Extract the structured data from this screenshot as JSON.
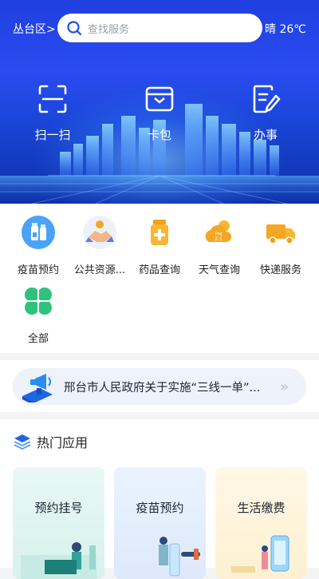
{
  "header": {
    "district": "丛台区>",
    "search_placeholder": "查找服务",
    "weather": "晴 26℃"
  },
  "quick_actions": [
    {
      "label": "扫一扫",
      "icon": "scan-icon"
    },
    {
      "label": "卡包",
      "icon": "card-wallet-icon"
    },
    {
      "label": "办事",
      "icon": "document-edit-icon"
    }
  ],
  "services": [
    {
      "label": "疫苗预约",
      "icon": "vaccine-icon"
    },
    {
      "label": "公共资源...",
      "icon": "handshake-icon"
    },
    {
      "label": "药品查询",
      "icon": "medicine-icon"
    },
    {
      "label": "天气查询",
      "icon": "weather-pm25-icon"
    },
    {
      "label": "快递服务",
      "icon": "delivery-truck-icon"
    },
    {
      "label": "全部",
      "icon": "all-clover-icon"
    }
  ],
  "notice": {
    "text": "邢台市人民政府关于实施“三线一单”..."
  },
  "hot_apps": {
    "title": "热门应用",
    "items": [
      {
        "label": "预约挂号"
      },
      {
        "label": "疫苗预约"
      },
      {
        "label": "生活缴费"
      }
    ]
  },
  "colors": {
    "brand_blue": "#2a4cf0",
    "accent_orange": "#f5a623",
    "accent_green": "#2fc27a"
  }
}
